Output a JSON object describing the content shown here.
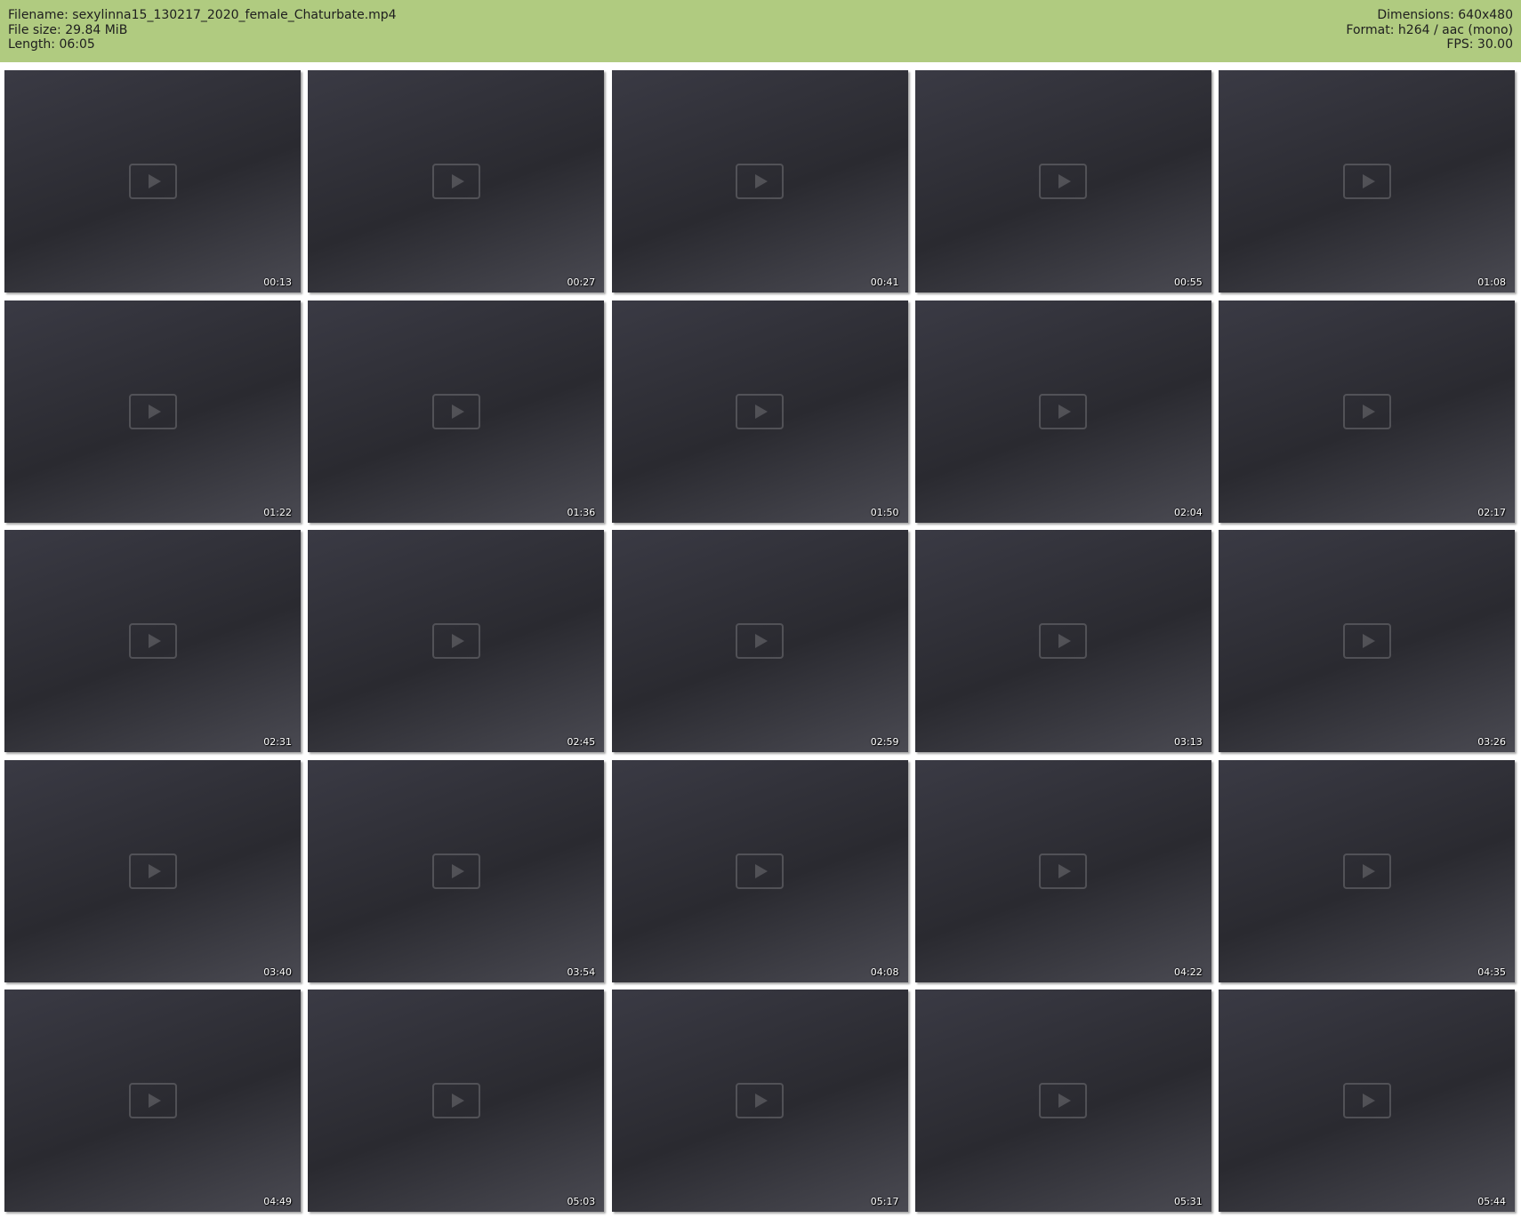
{
  "header": {
    "filename": "Filename: sexylinna15_130217_2020_female_Chaturbate.mp4",
    "file_size": "File size: 29.84 MiB",
    "length": "Length: 06:05",
    "dimensions": "Dimensions: 640x480",
    "format": "Format: h264 / aac (mono)",
    "fps": "FPS: 30.00"
  },
  "colors": {
    "header_bg": "#b0cb80"
  },
  "thumbnails": [
    {
      "time": "00:13"
    },
    {
      "time": "00:27"
    },
    {
      "time": "00:41"
    },
    {
      "time": "00:55"
    },
    {
      "time": "01:08"
    },
    {
      "time": "01:22"
    },
    {
      "time": "01:36"
    },
    {
      "time": "01:50"
    },
    {
      "time": "02:04"
    },
    {
      "time": "02:17"
    },
    {
      "time": "02:31"
    },
    {
      "time": "02:45"
    },
    {
      "time": "02:59"
    },
    {
      "time": "03:13"
    },
    {
      "time": "03:26"
    },
    {
      "time": "03:40"
    },
    {
      "time": "03:54"
    },
    {
      "time": "04:08"
    },
    {
      "time": "04:22"
    },
    {
      "time": "04:35"
    },
    {
      "time": "04:49"
    },
    {
      "time": "05:03"
    },
    {
      "time": "05:17"
    },
    {
      "time": "05:31"
    },
    {
      "time": "05:44"
    }
  ]
}
